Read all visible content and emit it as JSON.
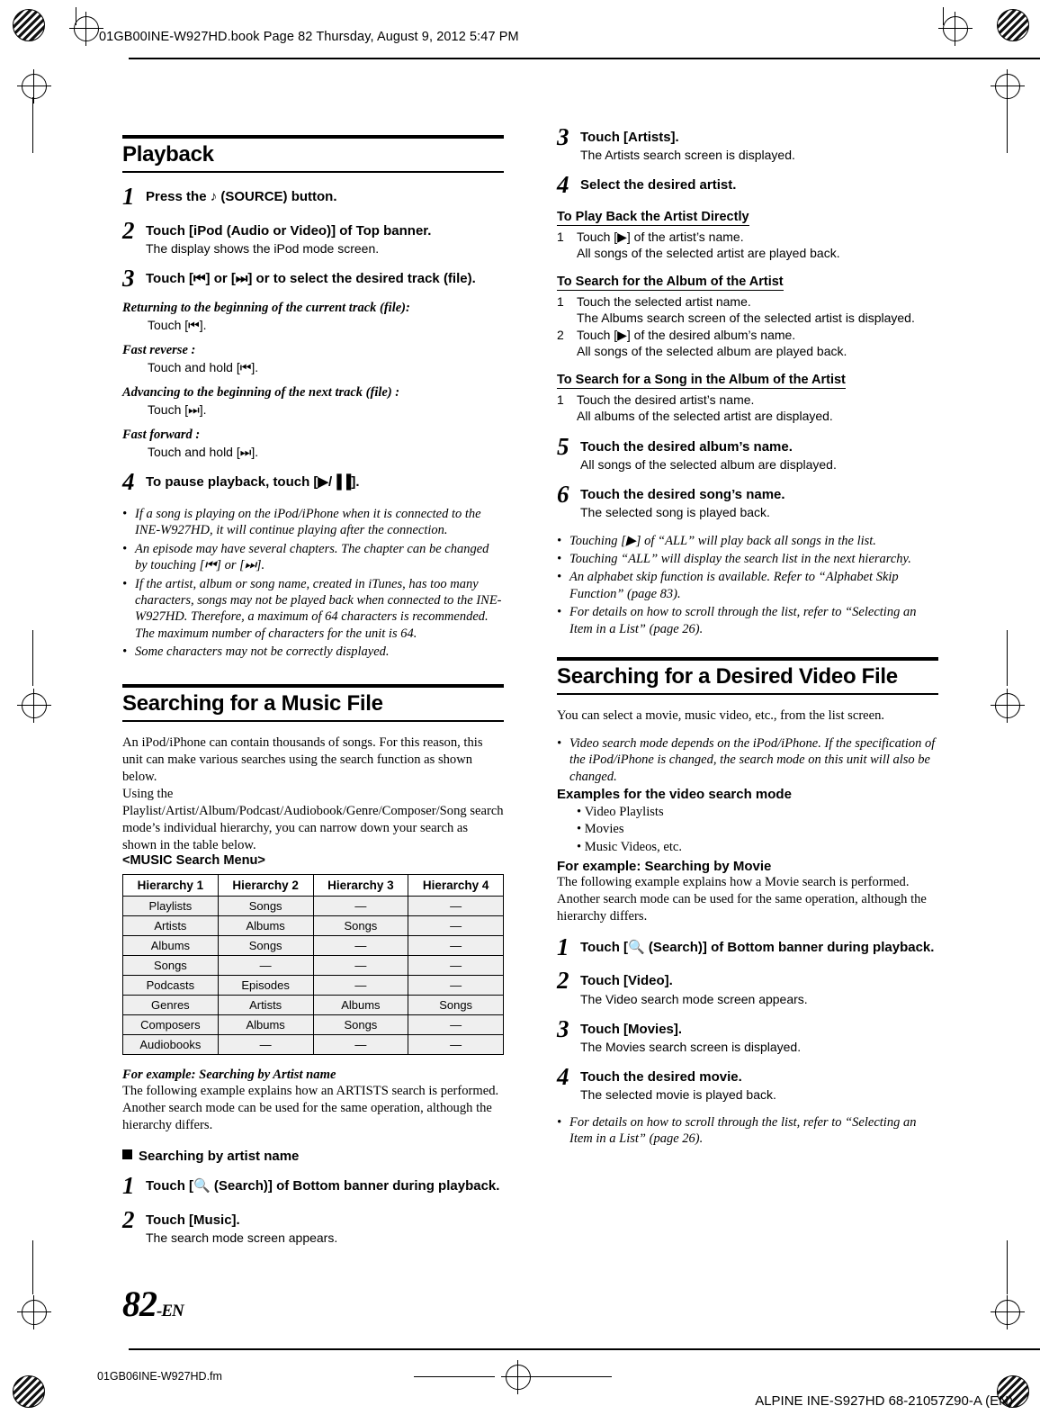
{
  "header": {
    "bookline": "01GB00INE-W927HD.book  Page 82  Thursday, August 9, 2012  5:47 PM"
  },
  "footer": {
    "page_number": "82",
    "page_suffix": "-EN",
    "file_name": "01GB06INE-W927HD.fm",
    "doc_code": "ALPINE INE-S927HD 68-21057Z90-A (EN)"
  },
  "left_column": {
    "section1_title": "Playback",
    "steps": [
      {
        "num": "1",
        "title": "Press the  ♪  (SOURCE) button.",
        "sub": ""
      },
      {
        "num": "2",
        "title": "Touch [iPod (Audio or Video)] of Top banner.",
        "sub": "The display shows the iPod mode screen."
      },
      {
        "num": "3",
        "title": "Touch [⏮] or [⏭] or to select the desired track (file).",
        "sub": ""
      },
      {
        "num": "4",
        "title": "To pause playback, touch [▶/▐▐].",
        "sub": ""
      }
    ],
    "subsections": [
      {
        "head": "Returning to the beginning of the current track (file):",
        "body": "Touch [⏮]."
      },
      {
        "head": "Fast reverse :",
        "body": "Touch and hold [⏮]."
      },
      {
        "head": "Advancing to the beginning of the next track (file) :",
        "body": "Touch [⏭]."
      },
      {
        "head": "Fast forward :",
        "body": "Touch and hold [⏭]."
      }
    ],
    "bullets": [
      "If a song is playing on the iPod/iPhone when it is connected to the INE-W927HD, it will continue playing after the connection.",
      "An episode may have several chapters. The chapter can be changed by touching [⏮] or [⏭].",
      "If the artist, album or song name, created in iTunes, has too many characters, songs may not be played back when connected to the INE-W927HD. Therefore, a maximum of 64 characters is recommended. The maximum number of characters for the unit is 64.",
      "Some characters may not be correctly displayed."
    ],
    "section2_title": "Searching for a Music File",
    "section2_paras": [
      "An iPod/iPhone can contain thousands of songs. For this reason, this unit can make various searches using the search function as shown below.",
      "Using the Playlist/Artist/Album/Podcast/Audiobook/Genre/Composer/Song search mode’s individual hierarchy, you can narrow down your search as shown in the table below."
    ],
    "menu_caption": "<MUSIC Search Menu>",
    "table": {
      "headers": [
        "Hierarchy 1",
        "Hierarchy 2",
        "Hierarchy 3",
        "Hierarchy 4"
      ],
      "rows": [
        [
          "Playlists",
          "Songs",
          "—",
          "—"
        ],
        [
          "Artists",
          "Albums",
          "Songs",
          "—"
        ],
        [
          "Albums",
          "Songs",
          "—",
          "—"
        ],
        [
          "Songs",
          "—",
          "—",
          "—"
        ],
        [
          "Podcasts",
          "Episodes",
          "—",
          "—"
        ],
        [
          "Genres",
          "Artists",
          "Albums",
          "Songs"
        ],
        [
          "Composers",
          "Albums",
          "Songs",
          "—"
        ],
        [
          "Audiobooks",
          "—",
          "—",
          "—"
        ]
      ]
    },
    "example_head": "For example: Searching by Artist name",
    "example_body": "The following example explains how an ARTISTS search is performed. Another search mode can be used for the same operation, although the hierarchy differs.",
    "square_head": "Searching by artist name",
    "steps2": [
      {
        "num": "1",
        "title": "Touch [🔍 (Search)] of Bottom banner during playback.",
        "sub": ""
      },
      {
        "num": "2",
        "title": "Touch [Music].",
        "sub": "The search mode screen appears."
      }
    ]
  },
  "right_column": {
    "steps": [
      {
        "num": "3",
        "title": "Touch [Artists].",
        "sub": "The Artists search screen is displayed."
      },
      {
        "num": "4",
        "title": "Select the desired artist.",
        "sub": ""
      }
    ],
    "sub_a": {
      "head": "To Play Back the Artist Directly",
      "rows": [
        {
          "n": "1",
          "t": "Touch [▶] of the artist’s name."
        },
        {
          "n": "",
          "t": "All songs of the selected artist are played back."
        }
      ]
    },
    "sub_b": {
      "head": "To Search for the Album of the Artist",
      "rows": [
        {
          "n": "1",
          "t": "Touch the selected artist name."
        },
        {
          "n": "",
          "t": "The Albums search screen of the selected artist is displayed."
        },
        {
          "n": "2",
          "t": "Touch [▶] of the desired album’s name."
        },
        {
          "n": "",
          "t": "All songs of the selected album are played back."
        }
      ]
    },
    "sub_c": {
      "head": "To Search for a Song in the Album of the Artist",
      "rows": [
        {
          "n": "1",
          "t": "Touch the desired artist’s name."
        },
        {
          "n": "",
          "t": "All albums of the selected artist are displayed."
        }
      ]
    },
    "steps2": [
      {
        "num": "5",
        "title": "Touch the desired album’s name.",
        "sub": "All songs of the selected album are displayed."
      },
      {
        "num": "6",
        "title": "Touch the desired song’s name.",
        "sub": "The selected song is played back."
      }
    ],
    "bullets": [
      "Touching [▶] of “ALL” will play back all songs in the list.",
      "Touching “ALL” will display the search list in the next hierarchy.",
      "An alphabet skip function is available. Refer to “Alphabet Skip Function” (page 83).",
      "For details on how to scroll through the list, refer to “Selecting an Item in a List” (page 26)."
    ],
    "section_title": "Searching for a Desired Video File",
    "intro": "You can select a movie, music video, etc., from the list screen.",
    "note_bullet": "Video search mode depends on the iPod/iPhone. If the specification of the iPod/iPhone is changed, the search mode on this unit will also be changed.",
    "examples_head": "Examples for the video search mode",
    "examples": [
      "Video Playlists",
      "Movies",
      "Music Videos, etc."
    ],
    "example_head": "For example: Searching by Movie",
    "example_body": "The following example explains how a Movie search is performed. Another search mode can be used for the same operation, although the hierarchy differs.",
    "steps3": [
      {
        "num": "1",
        "title": "Touch [🔍 (Search)]  of Bottom banner during playback.",
        "sub": ""
      },
      {
        "num": "2",
        "title": "Touch [Video].",
        "sub": "The Video search mode screen appears."
      },
      {
        "num": "3",
        "title": "Touch [Movies].",
        "sub": "The Movies search screen is displayed."
      },
      {
        "num": "4",
        "title": "Touch the desired movie.",
        "sub": "The selected movie is played back."
      }
    ],
    "final_bullet": "For details on how to scroll through the list, refer to “Selecting an Item in a List” (page 26)."
  }
}
